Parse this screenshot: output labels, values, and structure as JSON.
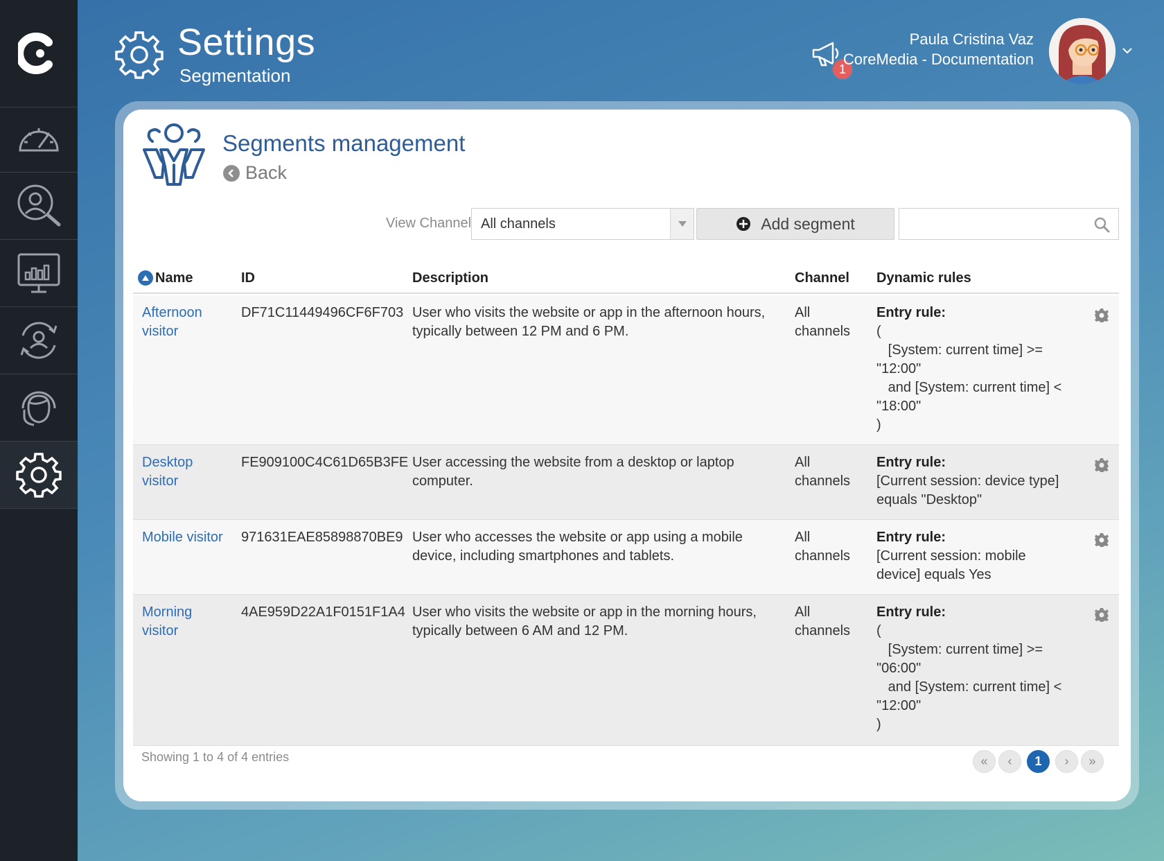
{
  "header": {
    "title": "Settings",
    "subtitle": "Segmentation",
    "notifications_count": "1",
    "user_name": "Paula Cristina Vaz",
    "user_org": "CoreMedia - Documentation"
  },
  "sidebar": {
    "items": [
      {
        "icon": "dashboard-gauge-icon"
      },
      {
        "icon": "user-search-icon"
      },
      {
        "icon": "analytics-monitor-icon"
      },
      {
        "icon": "user-cycle-icon"
      },
      {
        "icon": "support-agent-icon"
      },
      {
        "icon": "gear-icon",
        "active": true
      }
    ]
  },
  "card": {
    "title": "Segments management",
    "back_label": "Back"
  },
  "toolbar": {
    "view_channel_label": "View Channel:",
    "channel_selected": "All channels",
    "add_segment_label": "Add segment",
    "search_placeholder": ""
  },
  "table": {
    "columns": [
      "Name",
      "ID",
      "Description",
      "Channel",
      "Dynamic rules"
    ],
    "rows": [
      {
        "name": "Afternoon visitor",
        "id": "DF71C11449496CF6F703",
        "description": "User who visits the website or app in the afternoon hours, typically between 12 PM and 6 PM.",
        "channel": "All channels",
        "rule_label": "Entry rule:",
        "rule_text": "(\n   [System: current time] >= \"12:00\"\n   and [System: current time] < \"18:00\"\n)"
      },
      {
        "name": "Desktop visitor",
        "id": "FE909100C4C61D65B3FE",
        "description": "User accessing the website from a desktop or laptop computer.",
        "channel": "All channels",
        "rule_label": "Entry rule:",
        "rule_text": "[Current session: device type] equals \"Desktop\""
      },
      {
        "name": "Mobile visitor",
        "id": "971631EAE85898870BE9",
        "description": "User who accesses the website or app using a mobile device, including smartphones and tablets.",
        "channel": "All channels",
        "rule_label": "Entry rule:",
        "rule_text": "[Current session: mobile device] equals Yes"
      },
      {
        "name": "Morning visitor",
        "id": "4AE959D22A1F0151F1A4",
        "description": "User who visits the website or app in the morning hours, typically between 6 AM and 12 PM.",
        "channel": "All channels",
        "rule_label": "Entry rule:",
        "rule_text": "(\n   [System: current time] >= \"06:00\"\n   and [System: current time] < \"12:00\"\n)"
      }
    ]
  },
  "footer": {
    "showing": "Showing 1 to 4 of 4 entries",
    "pager": {
      "first": "«",
      "prev": "‹",
      "current": "1",
      "next": "›",
      "last": "»"
    }
  },
  "colors": {
    "accent": "#2d6db3",
    "sidebar": "#1d2228",
    "badge": "#e35e5e"
  }
}
